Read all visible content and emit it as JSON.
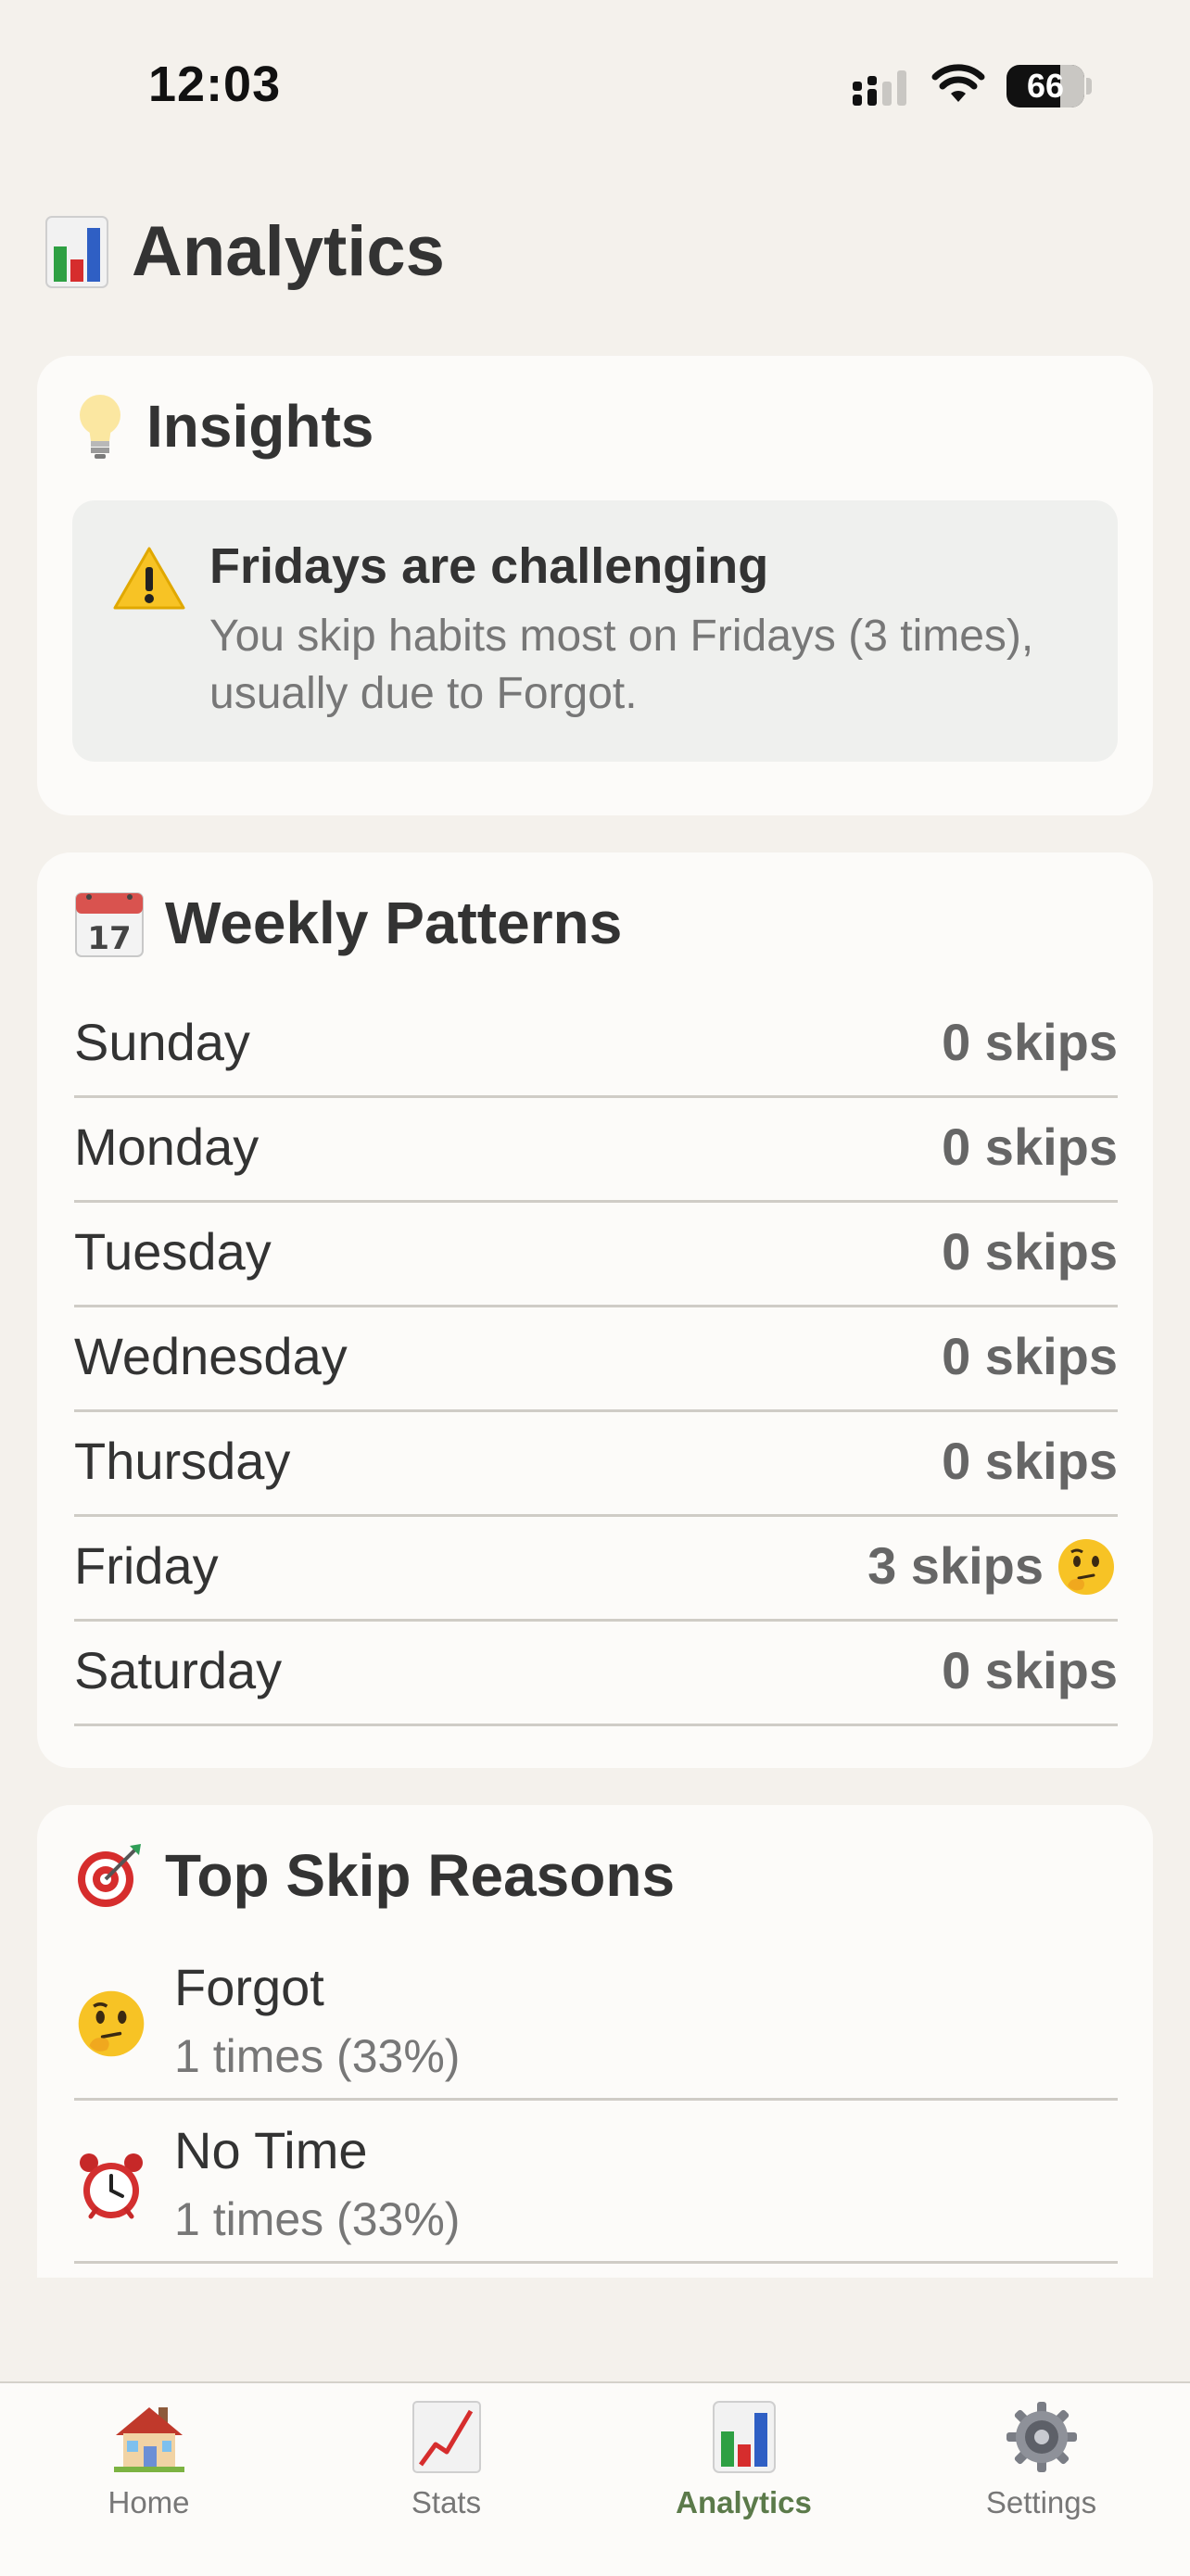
{
  "status_bar": {
    "time": "12:03",
    "battery": "66"
  },
  "header": {
    "title": "Analytics",
    "icon": "bar-chart-icon"
  },
  "insights": {
    "title": "Insights",
    "icon": "light-bulb-icon",
    "item": {
      "icon": "warning-icon",
      "title": "Fridays are challenging",
      "text": "You skip habits most on Fridays (3 times), usually due to Forgot."
    }
  },
  "weekly": {
    "title": "Weekly Patterns",
    "icon": "calendar-icon",
    "rows": [
      {
        "day": "Sunday",
        "value": "0 skips"
      },
      {
        "day": "Monday",
        "value": "0 skips"
      },
      {
        "day": "Tuesday",
        "value": "0 skips"
      },
      {
        "day": "Wednesday",
        "value": "0 skips"
      },
      {
        "day": "Thursday",
        "value": "0 skips"
      },
      {
        "day": "Friday",
        "value": "3 skips",
        "icon": "thinking-face-icon"
      },
      {
        "day": "Saturday",
        "value": "0 skips"
      }
    ]
  },
  "reasons": {
    "title": "Top Skip Reasons",
    "icon": "target-icon",
    "items": [
      {
        "icon": "thinking-face-icon",
        "name": "Forgot",
        "count": "1 times (33%)"
      },
      {
        "icon": "alarm-clock-icon",
        "name": "No Time",
        "count": "1 times (33%)"
      }
    ]
  },
  "tabs": [
    {
      "label": "Home",
      "icon": "house-icon"
    },
    {
      "label": "Stats",
      "icon": "line-chart-icon"
    },
    {
      "label": "Analytics",
      "icon": "bar-chart-icon",
      "active": true
    },
    {
      "label": "Settings",
      "icon": "gear-icon"
    }
  ],
  "colors": {
    "background": "#f4f1ec",
    "card": "#fcfbf9",
    "active_tab": "#5b7a4a"
  }
}
